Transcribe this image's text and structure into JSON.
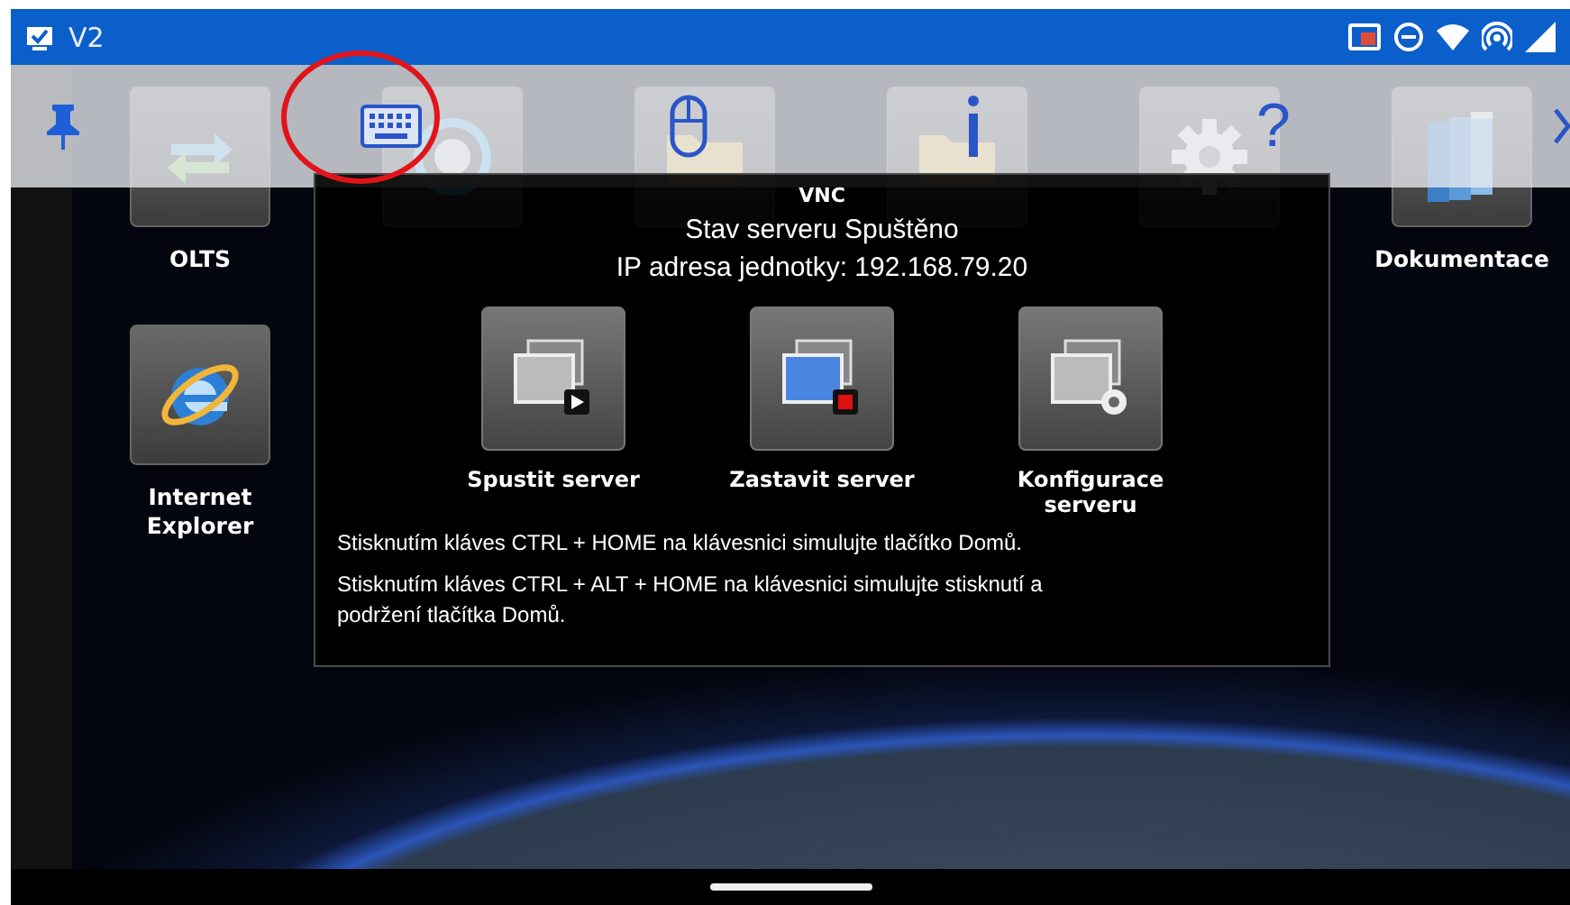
{
  "status_bar": {
    "app_label": "V2"
  },
  "toolbar": {
    "items": [
      {
        "kind": "pin"
      },
      {
        "kind": "keyboard"
      },
      {
        "kind": "mouse"
      },
      {
        "kind": "info"
      },
      {
        "kind": "help",
        "label": "?"
      },
      {
        "kind": "chevron"
      }
    ]
  },
  "desktop": {
    "rows": [
      [
        {
          "kind": "arrows",
          "label": "OLTS"
        },
        {
          "kind": "ring"
        },
        {
          "kind": "folder"
        },
        {
          "kind": "folder"
        },
        {
          "kind": "gear"
        },
        {
          "kind": "books",
          "label": "Dokumentace"
        }
      ],
      [
        {
          "kind": "browser",
          "label": "Internet Explorer"
        }
      ]
    ]
  },
  "dialog": {
    "title": "VNC",
    "status": "Stav serveru Spuštěno",
    "ip": "IP adresa jednotky: 192.168.79.20",
    "buttons": [
      {
        "kind": "start",
        "label": "Spustit server"
      },
      {
        "kind": "stop",
        "label": "Zastavit server"
      },
      {
        "kind": "config",
        "label": "Konfigurace serveru"
      }
    ],
    "notes": [
      "Stisknutím kláves CTRL + HOME na klávesnici simulujte tlačítko Domů.",
      "Stisknutím kláves CTRL + ALT + HOME na klávesnici simulujte stisknutí a podržení tlačítka Domů."
    ]
  }
}
